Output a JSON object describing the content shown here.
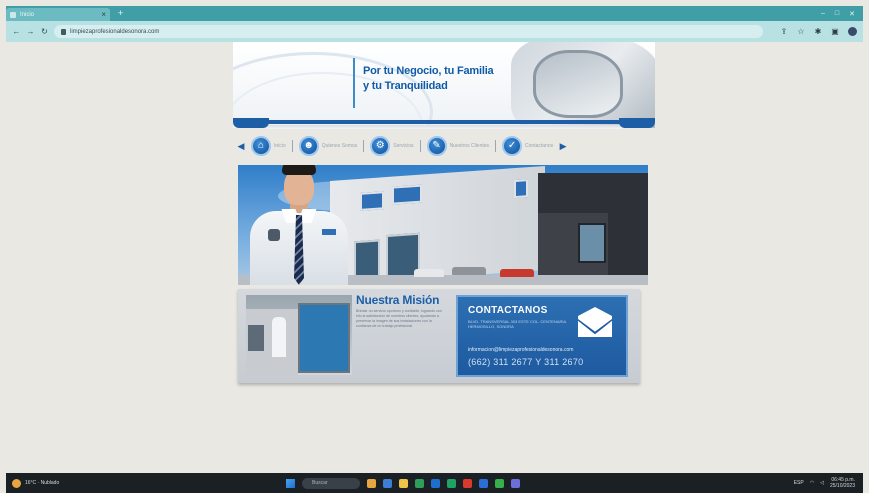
{
  "browser": {
    "tab_title": "Inicio",
    "new_tab_label": "+",
    "window_controls": [
      "–",
      "□",
      "✕"
    ],
    "url": "limpiezaprofesionaldesonora.com",
    "icons": [
      "back-icon",
      "forward-icon",
      "reload-icon",
      "lock-icon",
      "share-icon",
      "star-icon",
      "extensions-icon",
      "sidebar-icon",
      "profile-icon"
    ]
  },
  "site": {
    "hero": {
      "line1": "Por tu Negocio, tu Familia",
      "line2": "y tu Tranquilidad"
    },
    "menu": [
      {
        "label": "Inicio",
        "icon": "home-icon",
        "glyph": "⌂"
      },
      {
        "label": "Quienes Somos",
        "icon": "team-icon",
        "glyph": "☻"
      },
      {
        "label": "Servicios",
        "icon": "services-icon",
        "glyph": "⚙"
      },
      {
        "label": "Nuestros Clientes",
        "icon": "clients-icon",
        "glyph": "✎"
      },
      {
        "label": "Contactanos",
        "icon": "check-icon",
        "glyph": "✓"
      }
    ],
    "mision": {
      "title": "Nuestra Misión",
      "body": "Brindar un servicio oportuno y confiable, logrando con ello la satisfacción de nuestros clientes, ayudando a preservar la imagen de sus instalaciones con la confianza de un trabajo profesional."
    },
    "contact": {
      "title": "CONTACTANOS",
      "address": "BLVD. TRANSVERSAL 303 ESTE COL. CENTENARIA HERMOSILLO, SONORA",
      "email": "informacion@limpiezaprofesionaldesonora.com",
      "phone": "(662) 311 2677 Y 311 2670"
    }
  },
  "taskbar": {
    "weather": "16°C · Nublado",
    "search_placeholder": "Buscar",
    "time": "06:45 p.m.",
    "date": "25/10/2023",
    "lang": "ESP"
  },
  "colors": {
    "brand_blue": "#1e5ea6",
    "chrome_teal": "#3f9ea6"
  }
}
